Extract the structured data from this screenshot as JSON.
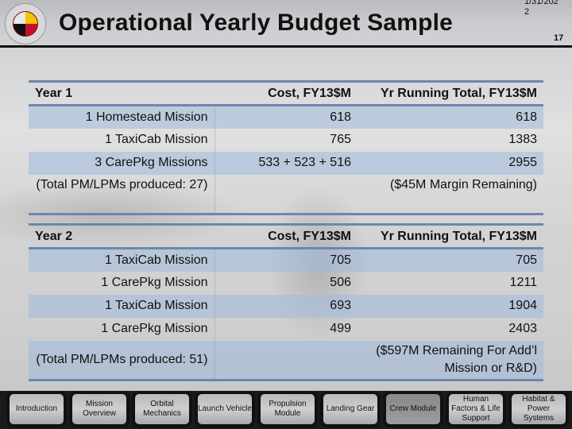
{
  "header": {
    "title": "Operational Yearly Budget Sample",
    "date": "1/31/202 2",
    "page_number": "17",
    "logo": "university-of-maryland-seal"
  },
  "year1": {
    "headers": [
      "Year 1",
      "Cost, FY13$M",
      "Yr Running Total, FY13$M"
    ],
    "rows": [
      {
        "mission": "1 Homestead Mission",
        "cost": "618",
        "running_total": "618"
      },
      {
        "mission": "1 TaxiCab Mission",
        "cost": "765",
        "running_total": "1383"
      },
      {
        "mission": "3 CarePkg Missions",
        "cost": "533 + 523 + 516",
        "running_total": "2955"
      },
      {
        "mission": "(Total PM/LPMs produced: 27)",
        "cost": "",
        "running_total": "($45M Margin Remaining)"
      }
    ]
  },
  "year2": {
    "headers": [
      "Year 2",
      "Cost, FY13$M",
      "Yr Running Total, FY13$M"
    ],
    "rows": [
      {
        "mission": "1 TaxiCab Mission",
        "cost": "705",
        "running_total": "705"
      },
      {
        "mission": "1 CarePkg Mission",
        "cost": "506",
        "running_total": "1211"
      },
      {
        "mission": "1 TaxiCab Mission",
        "cost": "693",
        "running_total": "1904"
      },
      {
        "mission": "1 CarePkg Mission",
        "cost": "499",
        "running_total": "2403"
      },
      {
        "mission": "(Total PM/LPMs produced: 51)",
        "cost": "",
        "running_total": "($597M Remaining For Add’l Mission or R&D)"
      }
    ]
  },
  "nav": {
    "items": [
      {
        "label": "Introduction"
      },
      {
        "label": "Mission Overview"
      },
      {
        "label": "Orbital Mechanics"
      },
      {
        "label": "Launch Vehicle"
      },
      {
        "label": "Propulsion Module"
      },
      {
        "label": "Landing Gear"
      },
      {
        "label": "Crew Module"
      },
      {
        "label": "Human Factors & Life Support"
      },
      {
        "label": "Habitat & Power Systems"
      }
    ]
  }
}
